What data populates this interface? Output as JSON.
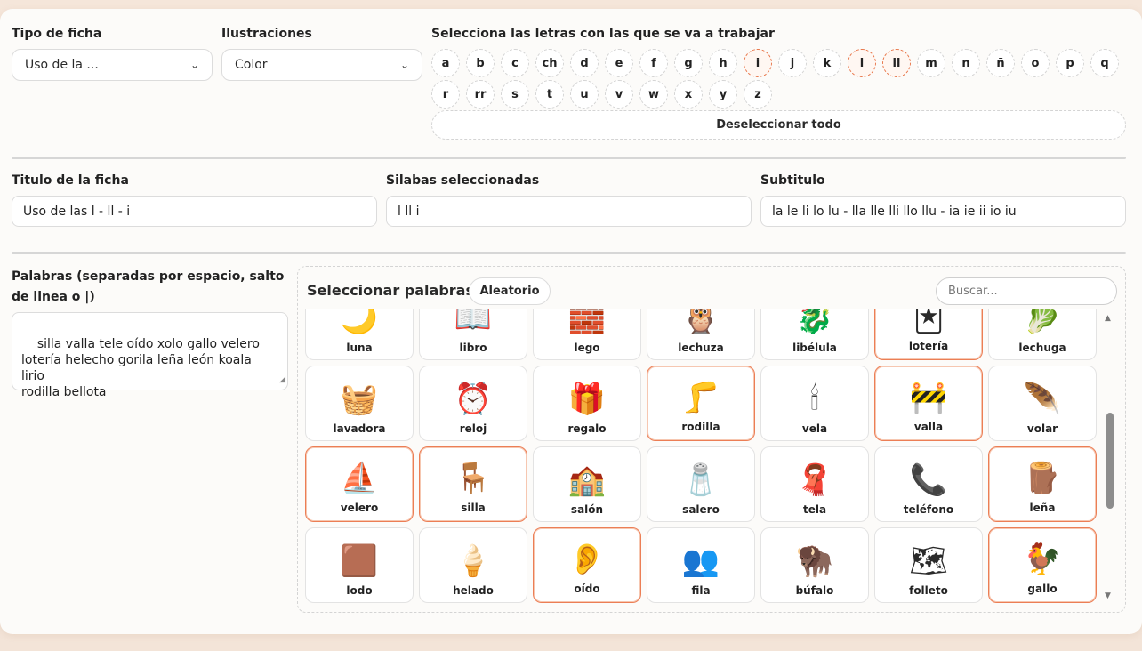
{
  "tipo_ficha": {
    "label": "Tipo de ficha",
    "value": "Uso de la ..."
  },
  "ilustraciones": {
    "label": "Ilustraciones",
    "value": "Color"
  },
  "letras": {
    "label": "Selecciona las letras con las que se va a trabajar",
    "row1": [
      "a",
      "b",
      "c",
      "ch",
      "d",
      "e",
      "f",
      "g",
      "h",
      "i",
      "j",
      "k",
      "l",
      "ll",
      "m",
      "n",
      "ñ",
      "o",
      "p",
      "q"
    ],
    "row2": [
      "r",
      "rr",
      "s",
      "t",
      "u",
      "v",
      "w",
      "x",
      "y",
      "z"
    ],
    "selected": [
      "i",
      "l",
      "ll"
    ],
    "deselect_label": "Deseleccionar todo"
  },
  "titulo": {
    "label": "Titulo de la ficha",
    "value": "Uso de las l - ll - i"
  },
  "silabas": {
    "label": "Silabas seleccionadas",
    "value": "l ll i"
  },
  "subtitulo": {
    "label": "Subtitulo",
    "value": "la le li lo lu - lla lle lli llo llu - ia ie ii io iu"
  },
  "palabras": {
    "label": "Palabras (separadas por espacio, salto de linea o |)",
    "value": "silla valla tele oído xolo gallo velero\nlotería helecho gorila leña león koala lirio\nrodilla bellota"
  },
  "selector": {
    "title": "Seleccionar palabras",
    "random_label": "Aleatorio",
    "search_placeholder": "Buscar...",
    "cards": [
      {
        "word": "luna",
        "icon": "🌙",
        "selected": false
      },
      {
        "word": "libro",
        "icon": "📖",
        "selected": false
      },
      {
        "word": "lego",
        "icon": "🧱",
        "selected": false
      },
      {
        "word": "lechuza",
        "icon": "🦉",
        "selected": false
      },
      {
        "word": "libélula",
        "icon": "🐉",
        "selected": false
      },
      {
        "word": "lotería",
        "icon": "🃏",
        "selected": true
      },
      {
        "word": "lechuga",
        "icon": "🥬",
        "selected": false
      },
      {
        "word": "lavadora",
        "icon": "🧺",
        "selected": false
      },
      {
        "word": "reloj",
        "icon": "⏰",
        "selected": false
      },
      {
        "word": "regalo",
        "icon": "🎁",
        "selected": false
      },
      {
        "word": "rodilla",
        "icon": "🦵",
        "selected": true
      },
      {
        "word": "vela",
        "icon": "🕯",
        "selected": false
      },
      {
        "word": "valla",
        "icon": "🚧",
        "selected": true
      },
      {
        "word": "volar",
        "icon": "🪶",
        "selected": false
      },
      {
        "word": "velero",
        "icon": "⛵",
        "selected": true
      },
      {
        "word": "silla",
        "icon": "🪑",
        "selected": true
      },
      {
        "word": "salón",
        "icon": "🏫",
        "selected": false
      },
      {
        "word": "salero",
        "icon": "🧂",
        "selected": false
      },
      {
        "word": "tela",
        "icon": "🧣",
        "selected": false
      },
      {
        "word": "teléfono",
        "icon": "📞",
        "selected": false
      },
      {
        "word": "leña",
        "icon": "🪵",
        "selected": true
      },
      {
        "word": "lodo",
        "icon": "🟫",
        "selected": false
      },
      {
        "word": "helado",
        "icon": "🍦",
        "selected": false
      },
      {
        "word": "oído",
        "icon": "👂",
        "selected": true
      },
      {
        "word": "fila",
        "icon": "👥",
        "selected": false
      },
      {
        "word": "búfalo",
        "icon": "🦬",
        "selected": false
      },
      {
        "word": "folleto",
        "icon": "🗺",
        "selected": false
      },
      {
        "word": "gallo",
        "icon": "🐓",
        "selected": true
      }
    ]
  }
}
